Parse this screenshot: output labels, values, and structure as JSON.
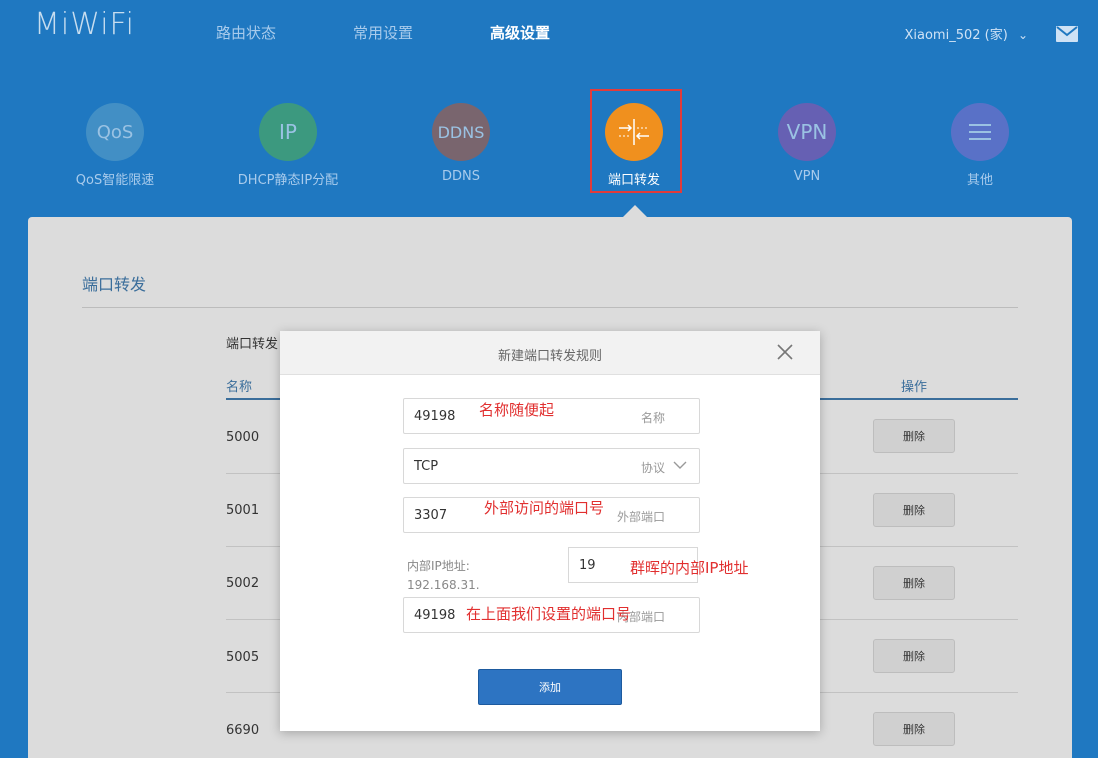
{
  "header": {
    "logo": "MiWiFi",
    "nav": [
      "路由状态",
      "常用设置",
      "高级设置"
    ],
    "active_nav": "高级设置",
    "user": "Xiaomi_502 (家)"
  },
  "features": [
    {
      "icon": "QoS",
      "label": "QoS智能限速",
      "color": "#5fa3c9"
    },
    {
      "icon": "IP",
      "label": "DHCP静态IP分配",
      "color": "#55b54a"
    },
    {
      "icon": "DDNS",
      "label": "DDNS",
      "color": "#c4562c"
    },
    {
      "icon": "port-forward-icon",
      "label": "端口转发",
      "color": "#f0901e"
    },
    {
      "icon": "VPN",
      "label": "VPN",
      "color": "#a04da8"
    },
    {
      "icon": "menu-icon",
      "label": "其他",
      "color": "#8a6dcc"
    }
  ],
  "section": {
    "title": "端口转发",
    "list_title": "端口转发",
    "columns": {
      "name": "名称",
      "action": "操作"
    },
    "rows": [
      {
        "name": "5000",
        "delete": "删除"
      },
      {
        "name": "5001",
        "delete": "删除"
      },
      {
        "name": "5002",
        "delete": "删除"
      },
      {
        "name": "5005",
        "delete": "删除"
      },
      {
        "name": "6690",
        "delete": "删除"
      }
    ]
  },
  "dialog": {
    "title": "新建端口转发规则",
    "name_value": "49198",
    "name_placeholder": "名称",
    "protocol_value": "TCP",
    "protocol_placeholder": "协议",
    "external_port_value": "3307",
    "external_port_placeholder": "外部端口",
    "internal_ip_label": "内部IP地址:",
    "internal_ip_prefix": "192.168.31.",
    "internal_ip_value": "19",
    "internal_port_value": "49198",
    "internal_port_placeholder": "内部端口",
    "add_button": "添加"
  },
  "annotations": {
    "name_note": "名称随便起",
    "external_port_note": "外部访问的端口号",
    "internal_ip_note": "群晖的内部IP地址",
    "internal_port_note": "在上面我们设置的端口号"
  },
  "colors": {
    "background": "#1f78c1",
    "annotation": "#e12f2f",
    "highlight": "#e23b3b",
    "primary_button": "#2d74c2"
  }
}
